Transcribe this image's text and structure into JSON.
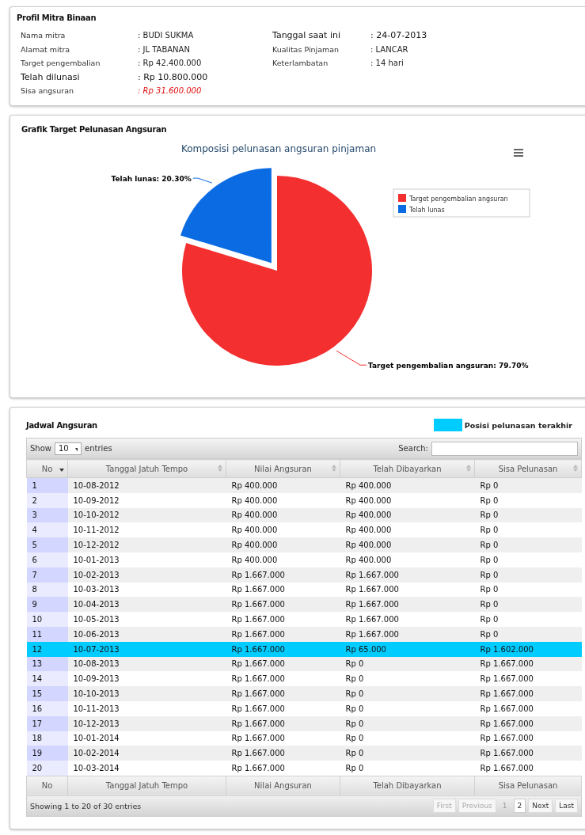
{
  "profile": {
    "title": "Profil Mitra Binaan",
    "left": [
      {
        "label": "Nama mitra",
        "value": ": BUDI SUKMA",
        "kind": "normal"
      },
      {
        "label": "Alamat mitra",
        "value": ": JL TABANAN",
        "kind": "normal"
      },
      {
        "label": "Target pengembalian",
        "value": ": Rp 42.400.000",
        "kind": "normal"
      },
      {
        "label": "Telah dilunasi",
        "value": ": Rp 10.800.000",
        "kind": "strong"
      },
      {
        "label": "Sisa angsuran",
        "value": ": Rp 31.600.000",
        "kind": "alert"
      }
    ],
    "right": [
      {
        "label": "Tanggal saat ini",
        "value": ": 24-07-2013",
        "kind": "strong"
      },
      {
        "label": "Kualitas Pinjaman",
        "value": ": LANCAR",
        "kind": "normal"
      },
      {
        "label": "Keterlambatan",
        "value": ": 14 hari",
        "kind": "normal"
      }
    ]
  },
  "chart_panel": {
    "title": "Grafik Target Pelunasan Angsuran",
    "chart_data": {
      "type": "pie",
      "title": "Komposisi pelunasan angsuran pinjaman",
      "categories": [
        "Target pengembalian angsuran",
        "Telah lunas"
      ],
      "values": [
        79.7,
        20.3
      ],
      "legend": true,
      "colors": [
        "#f42f2f",
        "#0b6be3"
      ],
      "value_labels": [
        "Target pengembalian angsuran: 79.70%",
        "Telah lunas: 20.30%"
      ]
    }
  },
  "schedule": {
    "title": "Jadwal Angsuran",
    "legend": {
      "label": "Posisi pelunasan terakhir",
      "color": "#00ccff"
    },
    "show_label": "Show",
    "page_size": "10",
    "entries_label": "entries",
    "search_label": "Search:",
    "columns": [
      {
        "label": "No",
        "sorted": true
      },
      {
        "label": "Tanggal Jatuh Tempo",
        "sorted": false
      },
      {
        "label": "Nilai Angsuran",
        "sorted": false
      },
      {
        "label": "Telah Dibayarkan",
        "sorted": false
      },
      {
        "label": "Sisa Pelunasan",
        "sorted": false
      }
    ],
    "rows": [
      {
        "cells": [
          "1",
          "10-08-2012",
          "Rp 400.000",
          "Rp 400.000",
          "Rp 0"
        ],
        "current": false
      },
      {
        "cells": [
          "2",
          "10-09-2012",
          "Rp 400.000",
          "Rp 400.000",
          "Rp 0"
        ],
        "current": false
      },
      {
        "cells": [
          "3",
          "10-10-2012",
          "Rp 400.000",
          "Rp 400.000",
          "Rp 0"
        ],
        "current": false
      },
      {
        "cells": [
          "4",
          "10-11-2012",
          "Rp 400.000",
          "Rp 400.000",
          "Rp 0"
        ],
        "current": false
      },
      {
        "cells": [
          "5",
          "10-12-2012",
          "Rp 400.000",
          "Rp 400.000",
          "Rp 0"
        ],
        "current": false
      },
      {
        "cells": [
          "6",
          "10-01-2013",
          "Rp 400.000",
          "Rp 400.000",
          "Rp 0"
        ],
        "current": false
      },
      {
        "cells": [
          "7",
          "10-02-2013",
          "Rp 1.667.000",
          "Rp 1.667.000",
          "Rp 0"
        ],
        "current": false
      },
      {
        "cells": [
          "8",
          "10-03-2013",
          "Rp 1.667.000",
          "Rp 1.667.000",
          "Rp 0"
        ],
        "current": false
      },
      {
        "cells": [
          "9",
          "10-04-2013",
          "Rp 1.667.000",
          "Rp 1.667.000",
          "Rp 0"
        ],
        "current": false
      },
      {
        "cells": [
          "10",
          "10-05-2013",
          "Rp 1.667.000",
          "Rp 1.667.000",
          "Rp 0"
        ],
        "current": false
      },
      {
        "cells": [
          "11",
          "10-06-2013",
          "Rp 1.667.000",
          "Rp 1.667.000",
          "Rp 0"
        ],
        "current": false
      },
      {
        "cells": [
          "12",
          "10-07-2013",
          "Rp 1.667.000",
          "Rp 65.000",
          "Rp 1.602.000"
        ],
        "current": true
      },
      {
        "cells": [
          "13",
          "10-08-2013",
          "Rp 1.667.000",
          "Rp 0",
          "Rp 1.667.000"
        ],
        "current": false
      },
      {
        "cells": [
          "14",
          "10-09-2013",
          "Rp 1.667.000",
          "Rp 0",
          "Rp 1.667.000"
        ],
        "current": false
      },
      {
        "cells": [
          "15",
          "10-10-2013",
          "Rp 1.667.000",
          "Rp 0",
          "Rp 1.667.000"
        ],
        "current": false
      },
      {
        "cells": [
          "16",
          "10-11-2013",
          "Rp 1.667.000",
          "Rp 0",
          "Rp 1.667.000"
        ],
        "current": false
      },
      {
        "cells": [
          "17",
          "10-12-2013",
          "Rp 1.667.000",
          "Rp 0",
          "Rp 1.667.000"
        ],
        "current": false
      },
      {
        "cells": [
          "18",
          "10-01-2014",
          "Rp 1.667.000",
          "Rp 0",
          "Rp 1.667.000"
        ],
        "current": false
      },
      {
        "cells": [
          "19",
          "10-02-2014",
          "Rp 1.667.000",
          "Rp 0",
          "Rp 1.667.000"
        ],
        "current": false
      },
      {
        "cells": [
          "20",
          "10-03-2014",
          "Rp 1.667.000",
          "Rp 0",
          "Rp 1.667.000"
        ],
        "current": false
      }
    ],
    "footer_columns": [
      "No",
      "Tanggal Jatuh Tempo",
      "Nilai Angsuran",
      "Telah Dibayarkan",
      "Sisa Pelunasan"
    ],
    "info": "Showing 1 to 20 of 30 entries",
    "pagination": [
      {
        "label": "First",
        "kind": "nav",
        "disabled": true
      },
      {
        "label": "Previous",
        "kind": "nav",
        "disabled": true
      },
      {
        "label": "1",
        "kind": "page",
        "selected": true
      },
      {
        "label": "2",
        "kind": "page",
        "selected": false
      },
      {
        "label": "Next",
        "kind": "nav",
        "disabled": false
      },
      {
        "label": "Last",
        "kind": "nav",
        "disabled": false
      }
    ]
  }
}
